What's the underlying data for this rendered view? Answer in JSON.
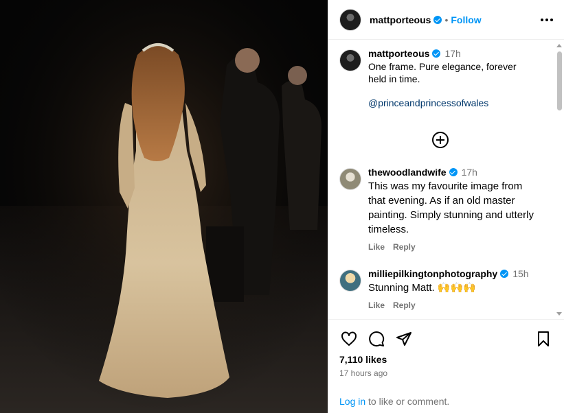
{
  "post": {
    "author": "mattporteous",
    "follow_label": "Follow",
    "separator": "•"
  },
  "caption": {
    "username": "mattporteous",
    "time": "17h",
    "text": "One frame. Pure elegance, forever held in time.",
    "mention": "@princeandprincessofwales"
  },
  "comments": [
    {
      "username": "thewoodlandwife",
      "time": "17h",
      "text": "This was my favourite image from that evening. As if an old master painting. Simply stunning and utterly timeless.",
      "like_label": "Like",
      "reply_label": "Reply"
    },
    {
      "username": "milliepilkingtonphotography",
      "time": "15h",
      "text": "Stunning Matt. 🙌🙌🙌",
      "like_label": "Like",
      "reply_label": "Reply"
    }
  ],
  "stats": {
    "likes": "7,110 likes",
    "posted_ago": "17 hours ago"
  },
  "login_prompt": {
    "link": "Log in",
    "rest": " to like or comment."
  },
  "icons": {
    "more": "more-options-icon",
    "like": "heart-icon",
    "comment": "comment-icon",
    "share": "share-icon",
    "save": "bookmark-icon",
    "load_more": "plus-circle-icon"
  },
  "colors": {
    "accent": "#0095f6",
    "link_dark": "#00376b",
    "muted": "#737373",
    "border": "#efefef"
  }
}
